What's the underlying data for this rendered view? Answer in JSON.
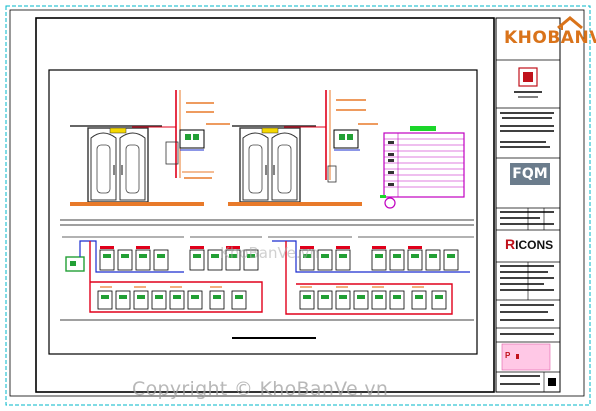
{
  "brand": {
    "name": "KHOBANVE",
    "color": "#d9731a"
  },
  "title_block": {
    "fqm_label": "FQM",
    "ricons_r": "R",
    "ricons_rest": "ICONS",
    "plan_label": "P"
  },
  "watermark": "KhoBanVe.vn",
  "copyright": "Copyright © KhoBanVe.vn",
  "colors": {
    "frame": "#000000",
    "cyan_border": "#00b7c8",
    "door": "#333333",
    "cable_red": "#e0001b",
    "cable_blue": "#1a2ccf",
    "leader_orange": "#e87a2a",
    "legend_magenta": "#c000c0",
    "legend_green": "#1bd62a",
    "device_green": "#22a035"
  }
}
